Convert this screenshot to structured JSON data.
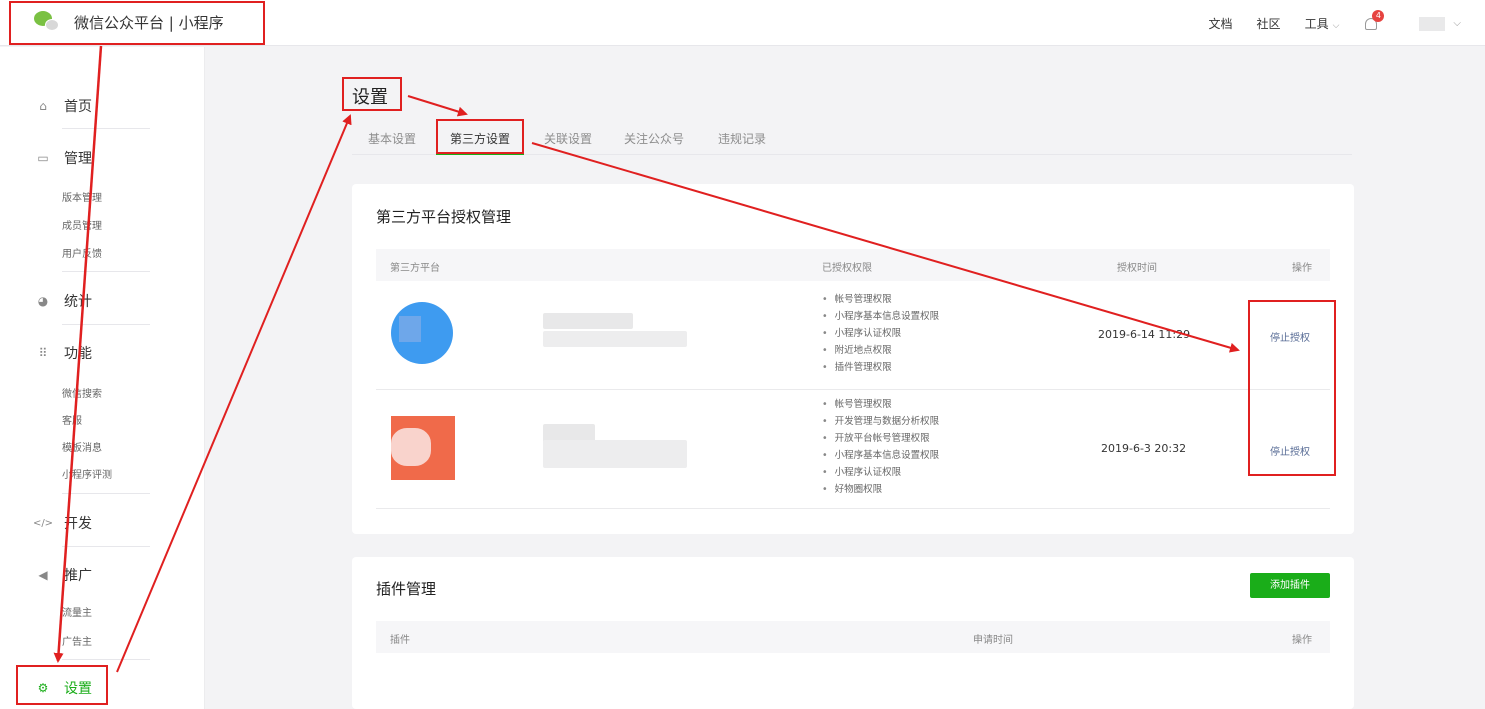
{
  "brand": {
    "title": "微信公众平台 | 小程序"
  },
  "topnav": {
    "docs": "文档",
    "community": "社区",
    "tools": "工具",
    "notif_count": "4"
  },
  "sidebar": {
    "home": "首页",
    "manage": "管理",
    "manage_items": [
      "版本管理",
      "成员管理",
      "用户反馈"
    ],
    "stats": "统计",
    "features": "功能",
    "feature_items": [
      "微信搜索",
      "客服",
      "模板消息",
      "小程序评测"
    ],
    "dev": "开发",
    "promo": "推广",
    "promo_items": [
      "流量主",
      "广告主"
    ],
    "settings": "设置"
  },
  "page": {
    "title": "设置",
    "tabs": [
      "基本设置",
      "第三方设置",
      "关联设置",
      "关注公众号",
      "违规记录"
    ]
  },
  "thirdparty": {
    "title": "第三方平台授权管理",
    "headers": [
      "第三方平台",
      "已授权权限",
      "授权时间",
      "操作"
    ],
    "rows": [
      {
        "permissions": [
          "帐号管理权限",
          "小程序基本信息设置权限",
          "小程序认证权限",
          "附近地点权限",
          "插件管理权限"
        ],
        "time": "2019-6-14 11:29",
        "action": "停止授权"
      },
      {
        "permissions": [
          "帐号管理权限",
          "开发管理与数据分析权限",
          "开放平台帐号管理权限",
          "小程序基本信息设置权限",
          "小程序认证权限",
          "好物圈权限"
        ],
        "time": "2019-6-3 20:32",
        "action": "停止授权"
      }
    ]
  },
  "plugins": {
    "title": "插件管理",
    "add_button": "添加插件",
    "headers": [
      "插件",
      "申请时间",
      "操作"
    ]
  },
  "colors": {
    "accent": "#1aad19",
    "link": "#576b95",
    "annotation": "#e02020"
  }
}
